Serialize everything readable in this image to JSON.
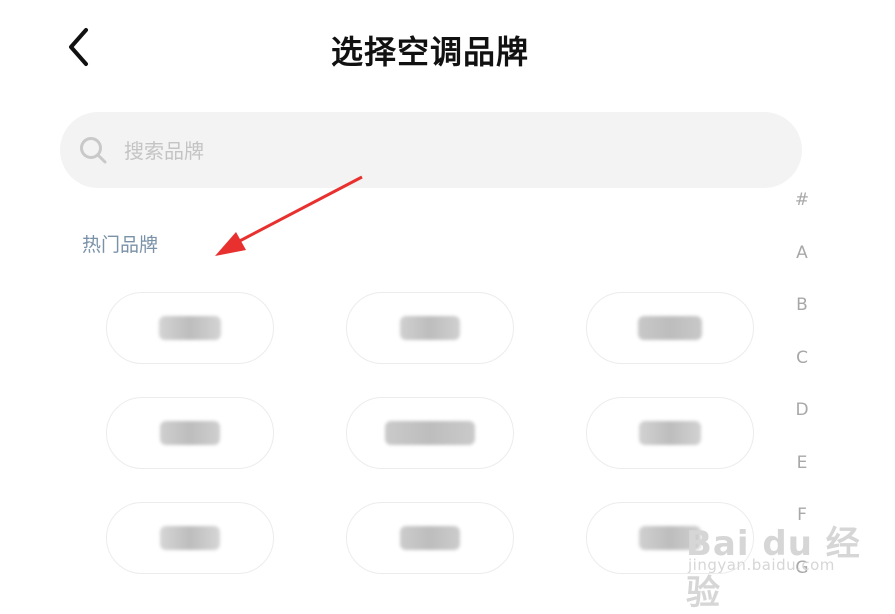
{
  "header": {
    "title": "选择空调品牌"
  },
  "search": {
    "placeholder": "搜索品牌"
  },
  "hot_brands": {
    "label": "热门品牌",
    "items": [
      {
        "label": "",
        "tint": "#d4d4d4"
      },
      {
        "label": "",
        "tint": "#d0d0d0"
      },
      {
        "label": "",
        "tint": "#c8c8c8"
      },
      {
        "label": "",
        "tint": "#cfcfcf"
      },
      {
        "label": "",
        "tint": "#cacaca"
      },
      {
        "label": "",
        "tint": "#d2d2d2"
      },
      {
        "label": "",
        "tint": "#d6d6d6"
      },
      {
        "label": "",
        "tint": "#cccccc"
      },
      {
        "label": "",
        "tint": "#d0d0d0"
      }
    ]
  },
  "alpha_index": [
    "#",
    "A",
    "B",
    "C",
    "D",
    "E",
    "F",
    "G"
  ],
  "annotation": {
    "arrow_color": "#e8312f"
  },
  "watermark": {
    "main": "Bai du 经验",
    "sub": "jingyan.baidu.com"
  }
}
